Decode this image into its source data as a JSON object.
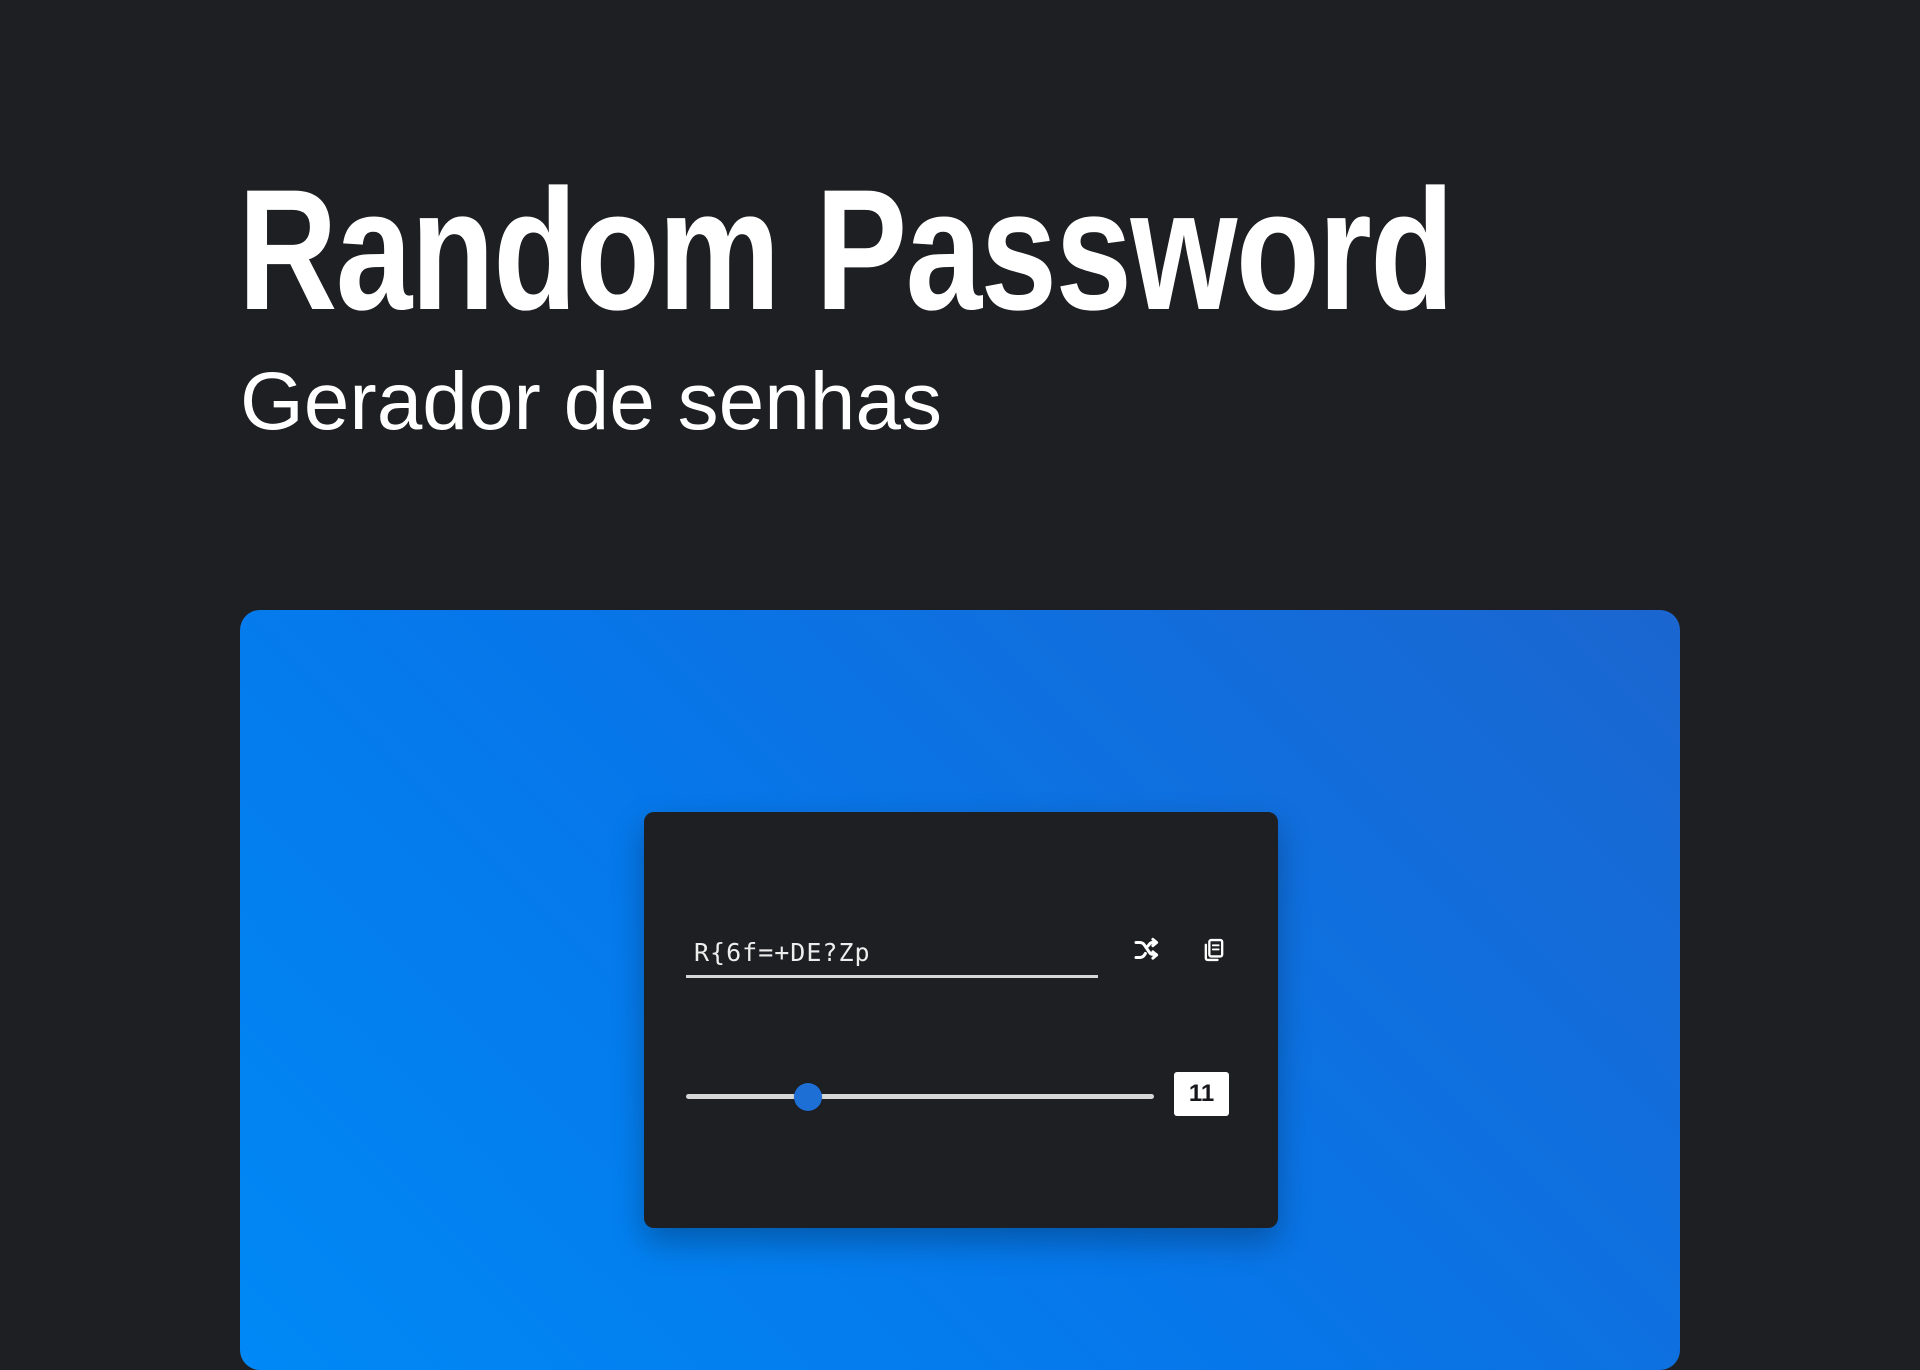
{
  "header": {
    "title": "Random Password",
    "subtitle": "Gerador de senhas"
  },
  "generator": {
    "password": "R{6f=+DE?Zp",
    "length": "11",
    "length_fraction": 0.26,
    "icons": {
      "shuffle": "shuffle-icon",
      "copy": "copy-icon"
    }
  },
  "colors": {
    "page_background": "#1e1f22",
    "panel_gradient_start": "#0089f6",
    "panel_gradient_end": "#1b66d0",
    "card_background": "#1e1f22",
    "accent": "#1d6fd6"
  }
}
